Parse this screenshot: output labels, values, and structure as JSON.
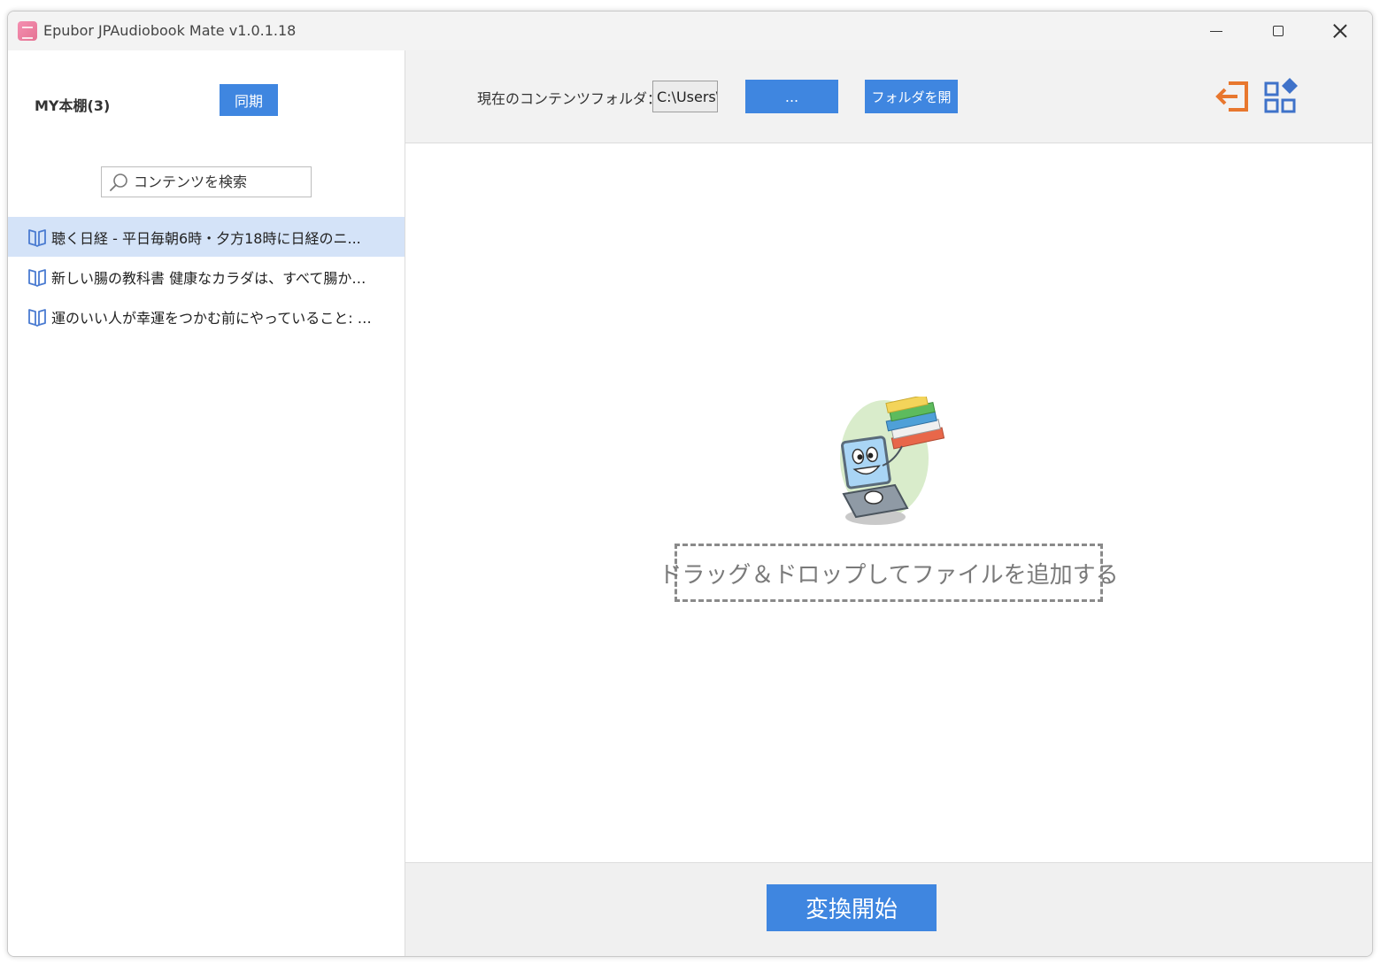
{
  "window": {
    "title": "Epubor JPAudiobook Mate v1.0.1.18",
    "controls": {
      "minimize": "minimize",
      "maximize": "maximize",
      "close": "close"
    }
  },
  "sidebar": {
    "shelf_title": "MY本棚(3)",
    "sync_label": "同期",
    "search": {
      "placeholder": "コンテンツを検索",
      "value": ""
    },
    "books": [
      {
        "title": "聴く日経 - 平日毎朝6時・夕方18時に日経のニ...",
        "selected": true
      },
      {
        "title": "新しい腸の教科書 健康なカラダは、すべて腸から...",
        "selected": false
      },
      {
        "title": "運のいい人が幸運をつかむ前にやっていること: セレ...",
        "selected": false
      }
    ]
  },
  "toolbar": {
    "folder_label": "現在のコンテンツフォルダ：",
    "folder_path": "C:\\Users\\",
    "browse_label": "...",
    "open_folder_label": "フォルダを開",
    "icons": {
      "exit": "exit-icon",
      "apps": "apps-icon"
    }
  },
  "main": {
    "drop_hint": "ドラッグ＆ドロップしてファイルを追加する"
  },
  "footer": {
    "convert_label": "変換開始"
  },
  "colors": {
    "accent": "#3f86e0",
    "selected_row": "#d4e3f8",
    "exit_icon": "#e8772e",
    "apps_icon": "#3f72c9"
  }
}
